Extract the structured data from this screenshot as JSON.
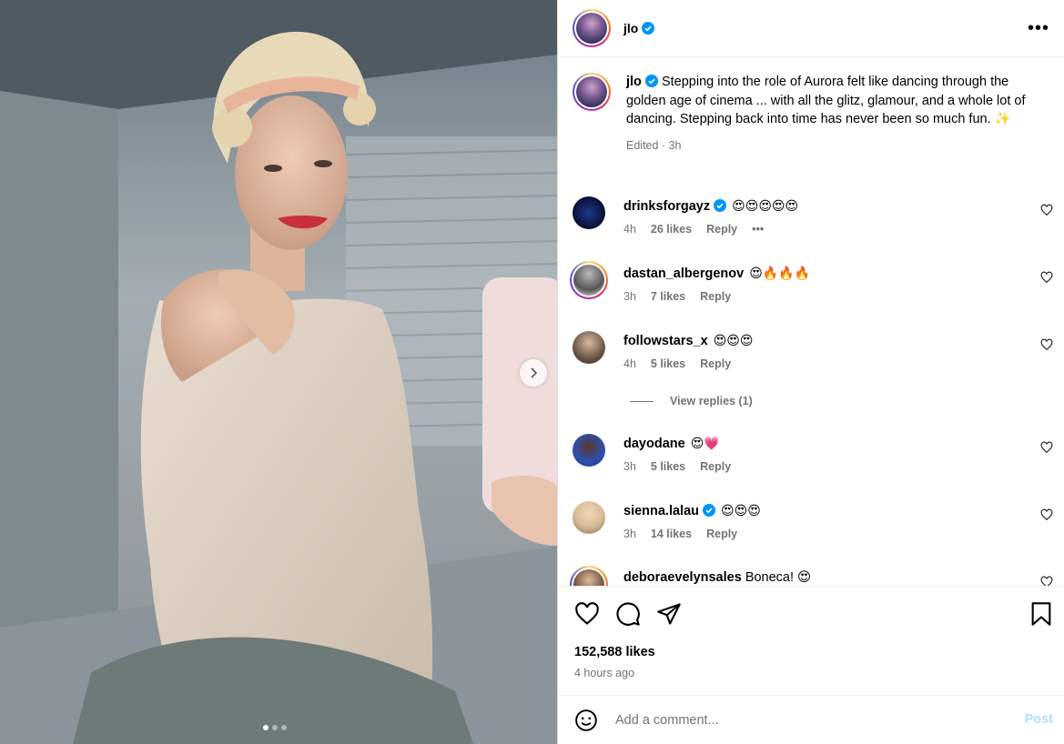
{
  "post": {
    "author": "jlo",
    "caption": "Stepping into the role of Aurora felt like dancing through the golden age of cinema ... with all the glitz, glamour, and a whole lot of dancing. Stepping back into time has never been so much fun.",
    "caption_emoji": "✨",
    "edited_label": "Edited · 3h",
    "likes": "152,588 likes",
    "time": "4 hours ago"
  },
  "comments": [
    {
      "user": "drinksforgayz",
      "verified": true,
      "text": "😍😍😍😍😍",
      "time": "4h",
      "likes": "26 likes",
      "reply": "Reply",
      "more": "•••"
    },
    {
      "user": "dastan_albergenov",
      "verified": false,
      "text": "😍🔥🔥🔥",
      "time": "3h",
      "likes": "7 likes",
      "reply": "Reply"
    },
    {
      "user": "followstars_x",
      "verified": false,
      "text": "😍😍😍",
      "time": "4h",
      "likes": "5 likes",
      "reply": "Reply"
    },
    {
      "user": "dayodane",
      "verified": false,
      "text": "😍💗",
      "time": "3h",
      "likes": "5 likes",
      "reply": "Reply"
    },
    {
      "user": "sienna.lalau",
      "verified": true,
      "text": "😍😍😍",
      "time": "3h",
      "likes": "14 likes",
      "reply": "Reply"
    },
    {
      "user": "deboraevelynsales",
      "verified": false,
      "text": "Boneca! 😍"
    }
  ],
  "view_replies": "View replies (1)",
  "add_comment": {
    "placeholder": "Add a comment...",
    "post_label": "Post"
  },
  "icons": {
    "more": "more-options-icon",
    "verified": "verified-badge-icon",
    "like": "heart-icon",
    "comment": "comment-bubble-icon",
    "share": "paper-plane-icon",
    "save": "bookmark-icon",
    "emoji": "emoji-icon",
    "next": "chevron-right-icon"
  },
  "colors": {
    "verified": "#0095f6",
    "post_disabled": "#b2dffc",
    "muted": "#737373"
  },
  "carousel": {
    "count": 3,
    "active": 1
  }
}
